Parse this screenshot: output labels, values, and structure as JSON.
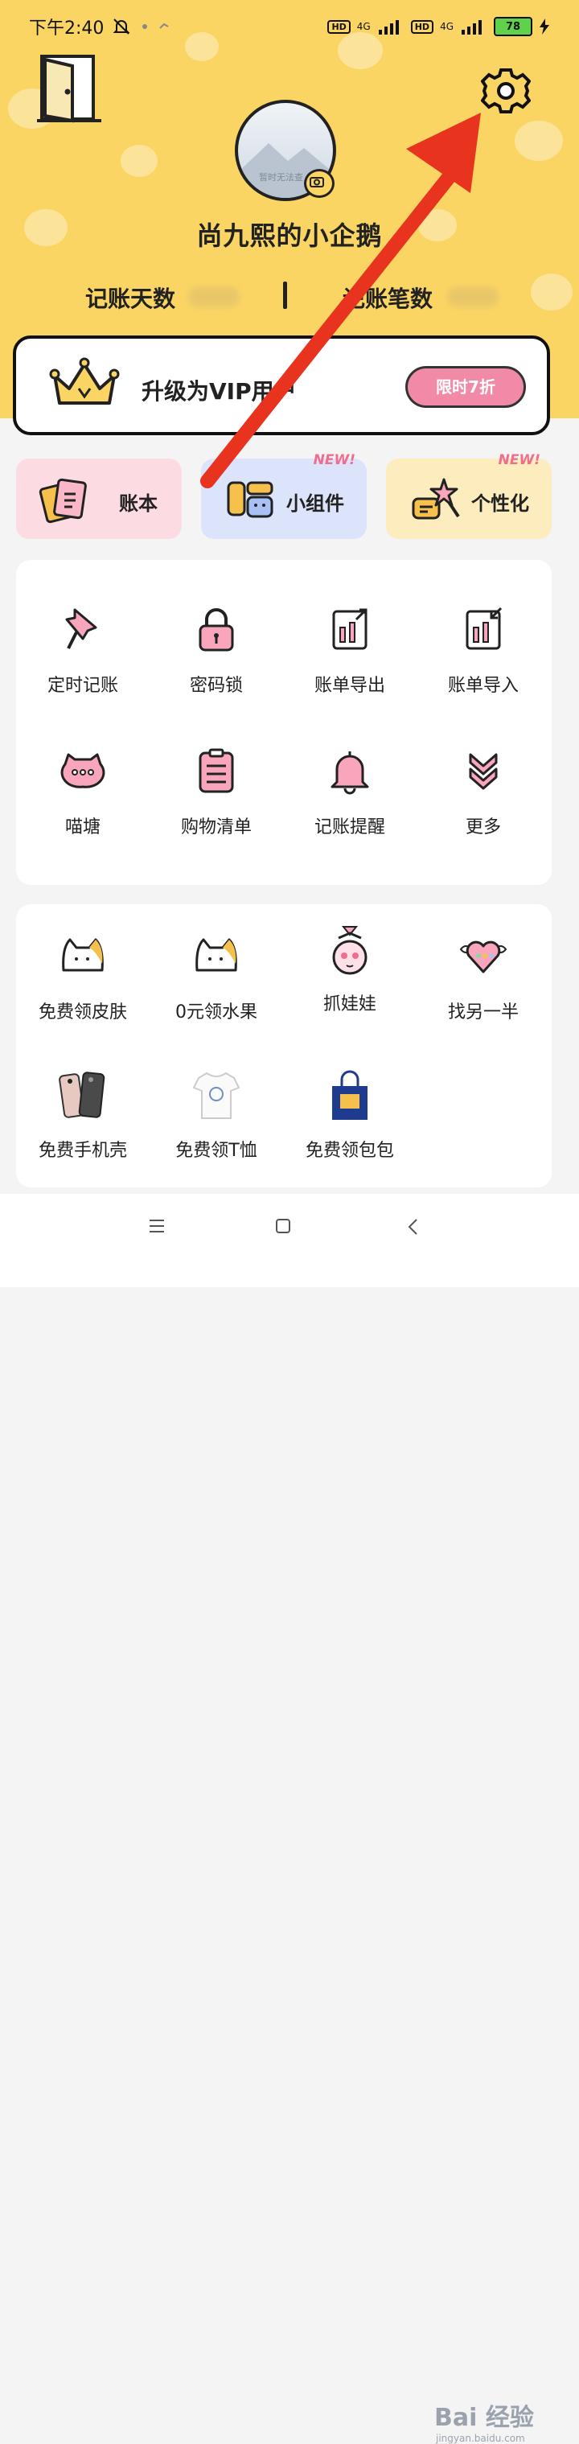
{
  "status_bar": {
    "time": "下午2:40",
    "battery": "78",
    "net1": "4G",
    "net2": "4G",
    "hd": "HD"
  },
  "profile": {
    "username": "尚九熙的小企鹅",
    "avatar_caption": "暂时无法查",
    "days_label": "记账天数",
    "count_label": "记账笔数"
  },
  "vip": {
    "title": "升级为VIP用户",
    "button": "限时7折"
  },
  "cards": [
    {
      "label": "账本",
      "bg": "#fcdbe3"
    },
    {
      "label": "小组件",
      "bg": "#dbe4fb",
      "tag": "NEW!"
    },
    {
      "label": "个性化",
      "bg": "#fdecbd",
      "tag": "NEW!"
    }
  ],
  "tools": [
    {
      "label": "定时记账",
      "icon": "pin-icon"
    },
    {
      "label": "密码锁",
      "icon": "lock-icon"
    },
    {
      "label": "账单导出",
      "icon": "export-icon"
    },
    {
      "label": "账单导入",
      "icon": "import-icon"
    },
    {
      "label": "喵塘",
      "icon": "chat-bubble-icon"
    },
    {
      "label": "购物清单",
      "icon": "clipboard-icon"
    },
    {
      "label": "记账提醒",
      "icon": "bell-icon"
    },
    {
      "label": "更多",
      "icon": "chevron-double-down-icon"
    }
  ],
  "promos": [
    {
      "label": "免费领皮肤",
      "icon": "cat-face-icon"
    },
    {
      "label": "0元领水果",
      "icon": "cat-face-icon"
    },
    {
      "label": "抓娃娃",
      "icon": "claw-toy-icon"
    },
    {
      "label": "找另一半",
      "icon": "winged-heart-icon"
    },
    {
      "label": "免费手机壳",
      "icon": "phone-case-icon"
    },
    {
      "label": "免费领T恤",
      "icon": "tshirt-icon"
    },
    {
      "label": "免费领包包",
      "icon": "tote-bag-icon"
    }
  ],
  "watermark": {
    "brand": "Bai 经验",
    "url": "jingyan.baidu.com"
  },
  "colors": {
    "header": "#fbd564",
    "accent_pink": "#f08aa6",
    "arrow": "#e8331f"
  }
}
